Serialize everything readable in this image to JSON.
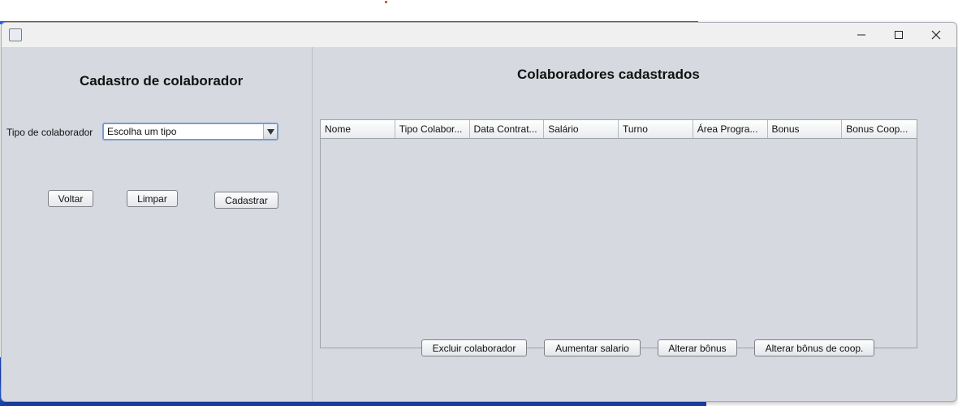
{
  "window": {
    "controls": [
      "minimize",
      "maximize",
      "close"
    ]
  },
  "left": {
    "title": "Cadastro de colaborador",
    "tipo_label": "Tipo de colaborador",
    "tipo_select": {
      "value": "Escolha um tipo"
    },
    "buttons": {
      "voltar": "Voltar",
      "limpar": "Limpar",
      "cadastrar": "Cadastrar"
    }
  },
  "right": {
    "title": "Colaboradores cadastrados",
    "table": {
      "columns": [
        "Nome",
        "Tipo Colabor...",
        "Data Contrat...",
        "Salário",
        "Turno",
        "Área Progra...",
        "Bonus",
        "Bonus Coop..."
      ],
      "rows": []
    },
    "buttons": {
      "excluir": "Excluir colaborador",
      "aumentar": "Aumentar salario",
      "alterar_bonus": "Alterar bônus",
      "alterar_bonus_coop": "Alterar bônus de coop."
    }
  }
}
